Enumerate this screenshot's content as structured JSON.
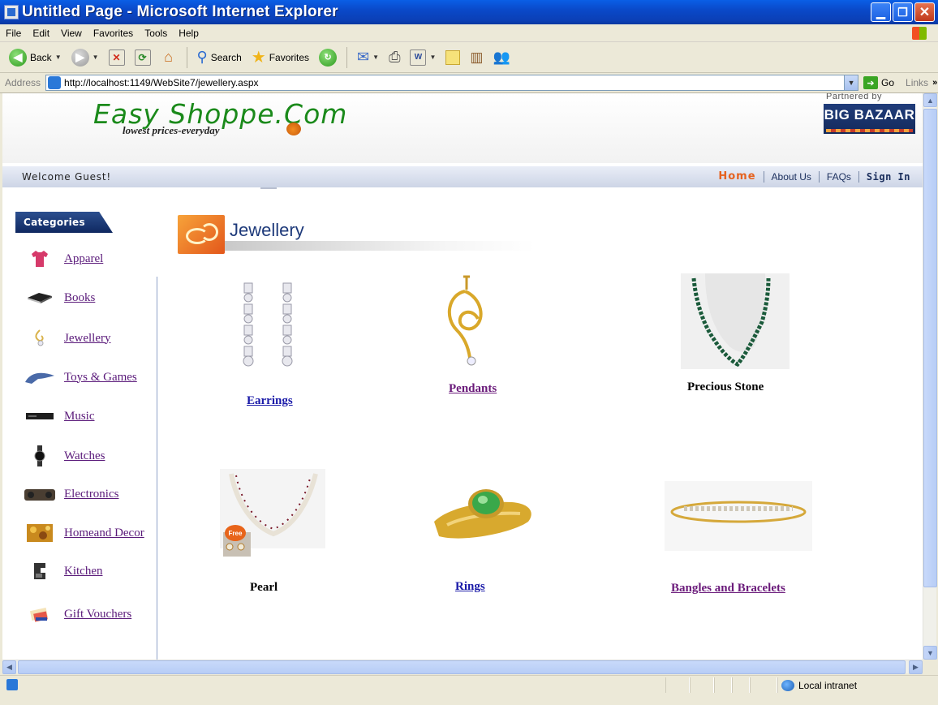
{
  "window": {
    "title": "Untitled Page - Microsoft Internet Explorer",
    "controls": [
      "minimize",
      "maximize",
      "close"
    ]
  },
  "menu": [
    "File",
    "Edit",
    "View",
    "Favorites",
    "Tools",
    "Help"
  ],
  "toolbar": {
    "back_label": "Back",
    "search_label": "Search",
    "favorites_label": "Favorites"
  },
  "address": {
    "label": "Address",
    "url": "http://localhost:1149/WebSite7/jewellery.aspx",
    "go_label": "Go",
    "links_label": "Links"
  },
  "site": {
    "logo": "Easy Shoppe.Com",
    "tagline": "lowest prices-everyday",
    "partner_label": "Partnered by",
    "partner_logo": "BIG BAZAAR",
    "welcome": "Welcome Guest!",
    "nav": {
      "home": "Home",
      "about": "About Us",
      "faqs": "FAQs",
      "signin": "Sign In"
    },
    "colors": {
      "home_accent": "#e5621f",
      "nav_text": "#1a2e5c"
    }
  },
  "sidebar": {
    "header": "Categories",
    "items": [
      {
        "label": "Apparel",
        "icon": "tshirt-icon"
      },
      {
        "label": "Books",
        "icon": "book-icon"
      },
      {
        "label": "Jewellery",
        "icon": "jewellery-icon"
      },
      {
        "label": "Toys & Games",
        "icon": "toy-icon"
      },
      {
        "label": "Music",
        "icon": "stereo-icon"
      },
      {
        "label": "Watches",
        "icon": "watch-icon"
      },
      {
        "label": "Electronics",
        "icon": "boombox-icon"
      },
      {
        "label": "Homeand Decor",
        "icon": "decor-icon"
      },
      {
        "label": "Kitchen",
        "icon": "kitchen-appliance-icon"
      },
      {
        "label": "Gift Vouchers",
        "icon": "voucher-icon"
      }
    ]
  },
  "main": {
    "section_title": "Jewellery",
    "products": [
      {
        "label": "Earrings",
        "is_link": true,
        "color": "#1a1aa8"
      },
      {
        "label": "Pendants",
        "is_link": true,
        "color": "#6a1a7a"
      },
      {
        "label": "Precious Stone",
        "is_link": false,
        "color": "#000000"
      },
      {
        "label": "Pearl",
        "is_link": false,
        "color": "#000000"
      },
      {
        "label": "Rings",
        "is_link": true,
        "color": "#1a1aa8"
      },
      {
        "label": "Bangles and Bracelets",
        "is_link": true,
        "color": "#6a1a7a"
      }
    ],
    "pearl_badge": "Free"
  },
  "status": {
    "zone": "Local intranet"
  }
}
